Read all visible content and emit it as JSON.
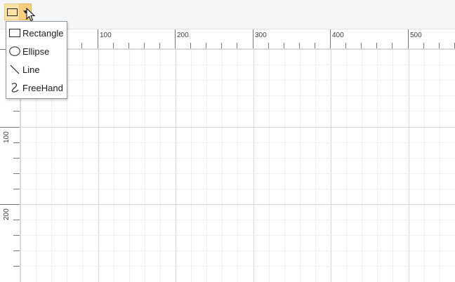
{
  "toolbar": {
    "shape_button_icon": "rectangle-icon",
    "dropdown_icon": "chevron-down-icon"
  },
  "shape_menu": {
    "items": [
      {
        "label": "Rectangle",
        "icon": "rectangle-icon"
      },
      {
        "label": "Ellipse",
        "icon": "ellipse-icon"
      },
      {
        "label": "Line",
        "icon": "line-icon"
      },
      {
        "label": "FreeHand",
        "icon": "freehand-icon"
      }
    ]
  },
  "ruler": {
    "horizontal_labels": [
      "100",
      "200",
      "300",
      "400",
      "500"
    ],
    "vertical_labels": [
      "100",
      "200"
    ]
  },
  "colors": {
    "accent": "#fbe3a8",
    "grid_minor": "#eef0f3",
    "grid_major": "#d3d6db"
  }
}
